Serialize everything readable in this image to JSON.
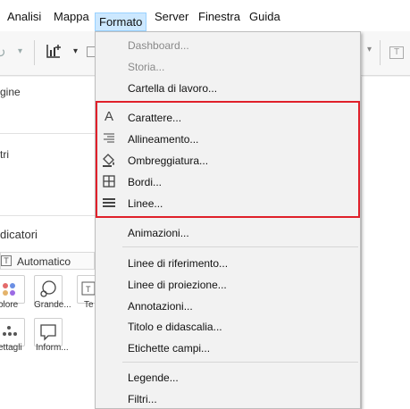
{
  "menubar": {
    "items": [
      {
        "label": "Analisi"
      },
      {
        "label": "Mappa"
      },
      {
        "label": "Formato"
      },
      {
        "label": "Server"
      },
      {
        "label": "Finestra"
      },
      {
        "label": "Guida"
      }
    ]
  },
  "left_pane": {
    "pages_fragment": "gine",
    "filters_fragment": "tri",
    "marks_fragment": "dicatori",
    "marks_dropdown": "Automatico",
    "mark_buttons": [
      {
        "label": "olore",
        "icon": "color-dots-icon"
      },
      {
        "label": "Grande...",
        "icon": "size-circles-icon"
      },
      {
        "label": "Te",
        "icon": "text-icon"
      },
      {
        "label": "ettagli",
        "icon": "detail-dots-icon"
      },
      {
        "label": "Inform...",
        "icon": "tooltip-bubble-icon"
      }
    ]
  },
  "format_menu": {
    "items_top": [
      {
        "label": "Dashboard...",
        "disabled": true
      },
      {
        "label": "Storia...",
        "disabled": true
      },
      {
        "label": "Cartella di lavoro...",
        "disabled": false
      }
    ],
    "items_highlighted": [
      {
        "label": "Carattere...",
        "icon": "font-a-icon"
      },
      {
        "label": "Allineamento...",
        "icon": "alignment-lines-icon"
      },
      {
        "label": "Ombreggiatura...",
        "icon": "paint-bucket-icon"
      },
      {
        "label": "Bordi...",
        "icon": "borders-grid-icon"
      },
      {
        "label": "Linee...",
        "icon": "lines-icon"
      }
    ],
    "item_animations": {
      "label": "Animazioni..."
    },
    "items_reference": [
      {
        "label": "Linee di riferimento..."
      },
      {
        "label": "Linee di proiezione..."
      },
      {
        "label": "Annotazioni..."
      },
      {
        "label": "Titolo e didascalia..."
      },
      {
        "label": "Etichette campi..."
      }
    ],
    "items_bottom": [
      {
        "label": "Legende..."
      },
      {
        "label": "Filtri..."
      }
    ],
    "highlight_color": "#e0202a"
  }
}
